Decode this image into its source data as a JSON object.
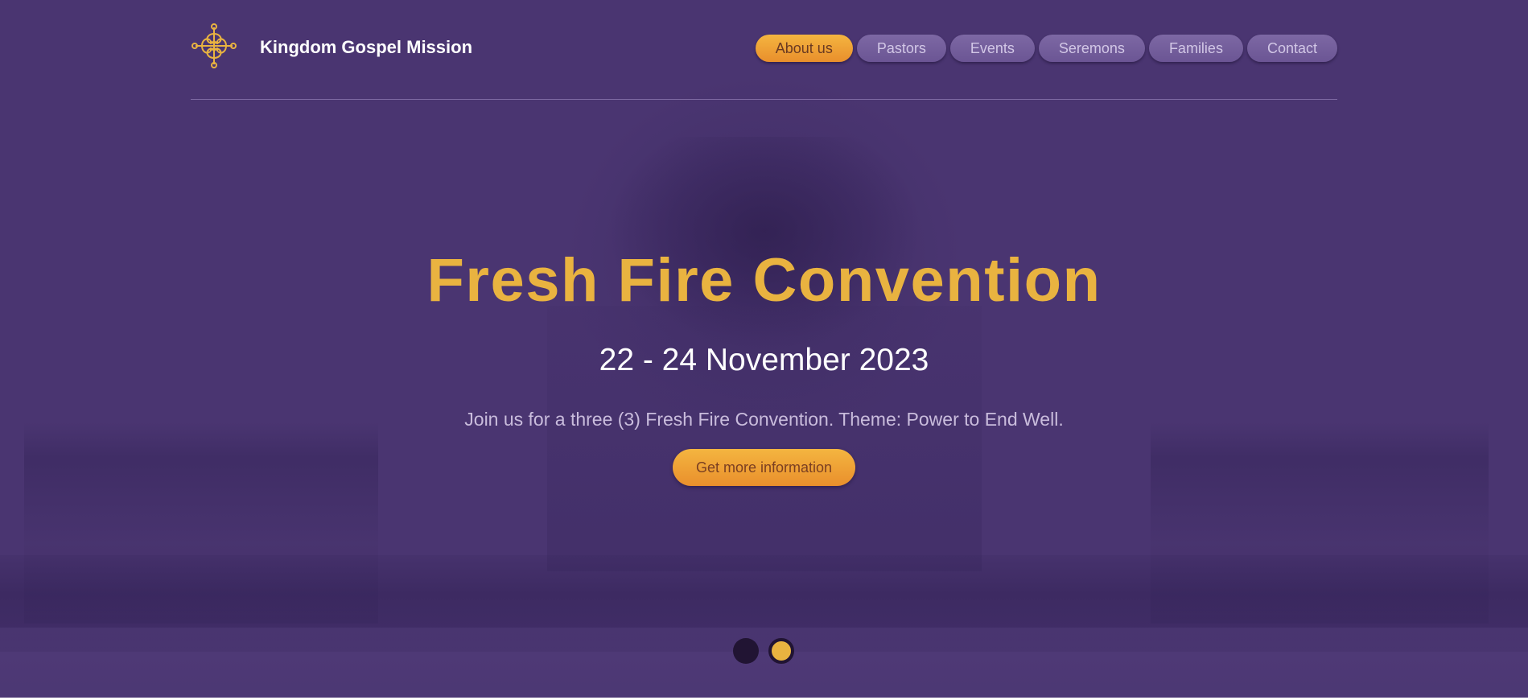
{
  "site": {
    "brand_name": "Kingdom Gospel Mission",
    "logo_icon": "ornate-cross-icon"
  },
  "nav": {
    "items": [
      {
        "label": "About us",
        "active": true
      },
      {
        "label": "Pastors",
        "active": false
      },
      {
        "label": "Events",
        "active": false
      },
      {
        "label": "Seremons",
        "active": false
      },
      {
        "label": "Families",
        "active": false
      },
      {
        "label": "Contact",
        "active": false
      }
    ]
  },
  "hero": {
    "title": "Fresh Fire Convention",
    "date": "22 - 24 November 2023",
    "description": "Join us for a three (3) Fresh Fire Convention. Theme: Power to End Well.",
    "cta_label": "Get more information"
  },
  "slider": {
    "slide_count": 2,
    "active_index": 2
  },
  "colors": {
    "background": "#4a3571",
    "accent": "#e9b340",
    "accent_gradient_end": "#e98f2c",
    "nav_pill": "#7563a0",
    "dot_dark": "#211433"
  }
}
